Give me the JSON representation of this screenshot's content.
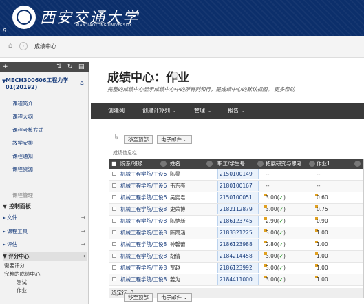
{
  "header": {
    "university_cn": "西安交通大学",
    "university_en": "XIAN JIAOTONG UNIVERSITY",
    "corner_mark": "8"
  },
  "breadcrumb": {
    "current": "成绩中心"
  },
  "sidebar": {
    "tools": [
      "+",
      "⇅",
      "↻",
      "▤"
    ],
    "course_title": "MECH300606工程力学01(20192)",
    "links": [
      "课程简介",
      "课程大纲",
      "课程考核方式",
      "教学安排",
      "课程通知",
      "课程资源"
    ],
    "section_label": "课程管理",
    "panel": "控制面板",
    "items": [
      {
        "label": "文件",
        "arrow": "→"
      },
      {
        "label": "课程工具",
        "arrow": "→"
      },
      {
        "label": "评估",
        "arrow": "→"
      },
      {
        "label": "评分中心",
        "arrow": "→"
      }
    ],
    "grade_sub": {
      "needs": "需要评分",
      "full": "完整的成绩中心",
      "test": "测试",
      "work": "作业"
    }
  },
  "main": {
    "title": "成绩中心：作业",
    "description": "完整的成绩中心显示成绩中心中的所有列和行，是成绩中心的默认视图。",
    "more_help": "更多帮助",
    "actions": [
      "创建列",
      "创建计算列 ⌄",
      "管理 ⌄",
      "报告 ⌄"
    ],
    "move_top": "移至顶部",
    "email": "电子邮件 ⌄",
    "grid_caption": "成绩信息栏",
    "columns": [
      "院系/班级",
      "姓名",
      "职工/学生号",
      "拓展研究与思考",
      "作业1"
    ],
    "rows": [
      {
        "dept": "机械工程学院/工设6",
        "name": "陈曼",
        "id": "2150100149",
        "ext": "--",
        "hw1": "--"
      },
      {
        "dept": "机械工程学院/工设6",
        "name": "韦东亮",
        "id": "2180100167",
        "ext": "--",
        "hw1": "--"
      },
      {
        "dept": "机械工程学院/工设6",
        "name": "吴奕君",
        "id": "2150100051",
        "ext": "3.00(✓)",
        "hw1": "0.60"
      },
      {
        "dept": "机械工程学院/工设8",
        "name": "史荣博",
        "id": "2182112879",
        "ext": "3.00(✓)",
        "hw1": "0.75"
      },
      {
        "dept": "机械工程学院/工设8",
        "name": "陈恺新",
        "id": "2186123745",
        "ext": "2.90(✓)",
        "hw1": "0.90"
      },
      {
        "dept": "机械工程学院/工设8",
        "name": "陈雨涵",
        "id": "2183321225",
        "ext": "3.00(✓)",
        "hw1": "1.00"
      },
      {
        "dept": "机械工程学院/工设8",
        "name": "钟馨蕾",
        "id": "2186123988",
        "ext": "2.80(✓)",
        "hw1": "1.00"
      },
      {
        "dept": "机械工程学院/工设8",
        "name": "胡倩",
        "id": "2184214458",
        "ext": "3.00(✓)",
        "hw1": "1.00"
      },
      {
        "dept": "机械工程学院/工设8",
        "name": "贾越",
        "id": "2186123992",
        "ext": "3.00(✓)",
        "hw1": "1.00"
      },
      {
        "dept": "机械工程学院/工设8",
        "name": "姜为",
        "id": "2184411000",
        "ext": "3.00(✓)",
        "hw1": "1.00"
      }
    ],
    "selected_rows": "选定行: 0"
  }
}
